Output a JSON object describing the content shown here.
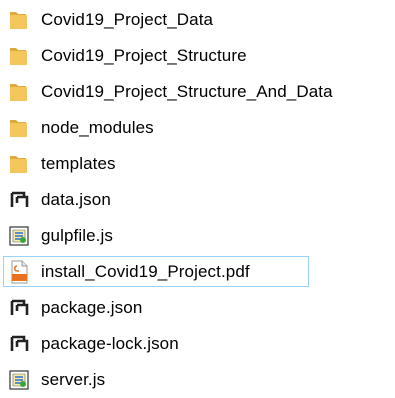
{
  "items": [
    {
      "label": "Covid19_Project_Data",
      "type": "folder",
      "icon": "folder-icon"
    },
    {
      "label": "Covid19_Project_Structure",
      "type": "folder",
      "icon": "folder-icon"
    },
    {
      "label": "Covid19_Project_Structure_And_Data",
      "type": "folder",
      "icon": "folder-icon"
    },
    {
      "label": "node_modules",
      "type": "folder",
      "icon": "folder-icon"
    },
    {
      "label": "templates",
      "type": "folder",
      "icon": "folder-icon"
    },
    {
      "label": "data.json",
      "type": "json",
      "icon": "json-file-icon"
    },
    {
      "label": "gulpfile.js",
      "type": "js",
      "icon": "js-file-icon"
    },
    {
      "label": "install_Covid19_Project.pdf",
      "type": "pdf",
      "icon": "pdf-file-icon",
      "selected": true
    },
    {
      "label": "package.json",
      "type": "json",
      "icon": "json-file-icon"
    },
    {
      "label": "package-lock.json",
      "type": "json",
      "icon": "json-file-icon"
    },
    {
      "label": "server.js",
      "type": "js",
      "icon": "js-file-icon"
    }
  ],
  "colors": {
    "folder": "#f4c65b",
    "folder_shade": "#dca93a",
    "pdf_accent": "#e8731e",
    "selection_border": "#99d1ff"
  }
}
